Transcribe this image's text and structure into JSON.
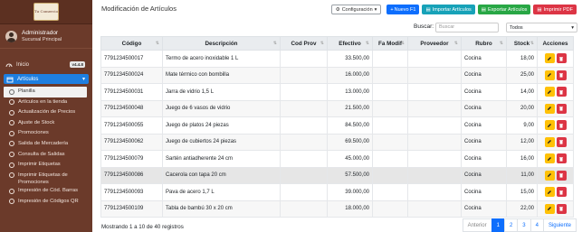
{
  "brand": {
    "logo_text": "Tu Comercio"
  },
  "user": {
    "name": "Administrador",
    "branch": "Sucursal Principal"
  },
  "nav": {
    "inicio": {
      "label": "Inicio",
      "badge": "v4.4.8"
    },
    "articulos": {
      "label": "Artículos"
    },
    "sub_items": [
      "Planilla",
      "Artículos en la tienda",
      "Actualización de Precios",
      "Ajuste de Stock",
      "Promociones",
      "Salida de Mercadería",
      "Consulta de Salidas",
      "Imprimir Etiquetas",
      "Imprimir Etiquetas de Promociones",
      "Impresión de Cód. Barras",
      "Impresión de Códigos QR"
    ]
  },
  "page": {
    "title": "Modificación de Artículos"
  },
  "toolbar": {
    "config_label": "Configuración",
    "new_label": "Nuevo F1",
    "import_label": "Importar Artículos",
    "export_label": "Exportar Artículos",
    "print_label": "Imprimir PDF"
  },
  "search": {
    "label": "Buscar:",
    "placeholder": "Buscar",
    "filter_value": "Todos"
  },
  "table": {
    "headers": [
      "Código",
      "Descripción",
      "Cod Prov",
      "Efectivo",
      "Fa Modif",
      "Proveedor",
      "Rubro",
      "Stock",
      "Acciones"
    ],
    "rows": [
      {
        "codigo": "7791234500017",
        "descripcion": "Termo de acero inoxidable 1 L",
        "cod_prov": "",
        "efectivo": "33.500,00",
        "fa_modif": "",
        "proveedor": "",
        "rubro": "Cocina",
        "stock": "18,00"
      },
      {
        "codigo": "7791234500024",
        "descripcion": "Mate térmico con bombilla",
        "cod_prov": "",
        "efectivo": "16.000,00",
        "fa_modif": "",
        "proveedor": "",
        "rubro": "Cocina",
        "stock": "25,00"
      },
      {
        "codigo": "7791234500031",
        "descripcion": "Jarra de vidrio 1,5 L",
        "cod_prov": "",
        "efectivo": "13.000,00",
        "fa_modif": "",
        "proveedor": "",
        "rubro": "Cocina",
        "stock": "14,00"
      },
      {
        "codigo": "7791234500048",
        "descripcion": "Juego de 6 vasos de vidrio",
        "cod_prov": "",
        "efectivo": "21.500,00",
        "fa_modif": "",
        "proveedor": "",
        "rubro": "Cocina",
        "stock": "20,00"
      },
      {
        "codigo": "7791234500055",
        "descripcion": "Juego de platos 24 piezas",
        "cod_prov": "",
        "efectivo": "84.500,00",
        "fa_modif": "",
        "proveedor": "",
        "rubro": "Cocina",
        "stock": "9,00"
      },
      {
        "codigo": "7791234500062",
        "descripcion": "Juego de cubiertos 24 piezas",
        "cod_prov": "",
        "efectivo": "69.500,00",
        "fa_modif": "",
        "proveedor": "",
        "rubro": "Cocina",
        "stock": "12,00"
      },
      {
        "codigo": "7791234500079",
        "descripcion": "Sartén antiadherente 24 cm",
        "cod_prov": "",
        "efectivo": "45.000,00",
        "fa_modif": "",
        "proveedor": "",
        "rubro": "Cocina",
        "stock": "16,00"
      },
      {
        "codigo": "7791234500086",
        "descripcion": "Cacerola con tapa 20 cm",
        "cod_prov": "",
        "efectivo": "57.500,00",
        "fa_modif": "",
        "proveedor": "",
        "rubro": "Cocina",
        "stock": "11,00"
      },
      {
        "codigo": "7791234500093",
        "descripcion": "Pava de acero 1,7 L",
        "cod_prov": "",
        "efectivo": "39.000,00",
        "fa_modif": "",
        "proveedor": "",
        "rubro": "Cocina",
        "stock": "15,00"
      },
      {
        "codigo": "7791234500109",
        "descripcion": "Tabla de bambú 30 x 20 cm",
        "cod_prov": "",
        "efectivo": "18.000,00",
        "fa_modif": "",
        "proveedor": "",
        "rubro": "Cocina",
        "stock": "22,00"
      }
    ],
    "highlighted_row": 7
  },
  "footer": {
    "info": "Mostrando 1 a 10 de 40 registros"
  },
  "pagination": {
    "prev": "Anterior",
    "pages": [
      "1",
      "2",
      "3",
      "4"
    ],
    "active": "1",
    "next": "Siguiente"
  },
  "colors": {
    "sidebar": "#6b3a2a",
    "accent": "#0d6efd",
    "edit": "#ffc107",
    "delete": "#dc3545"
  },
  "icons": {
    "edit": "pencil-icon",
    "delete": "trash-icon",
    "config": "gear-icon",
    "new": "plus-icon"
  }
}
